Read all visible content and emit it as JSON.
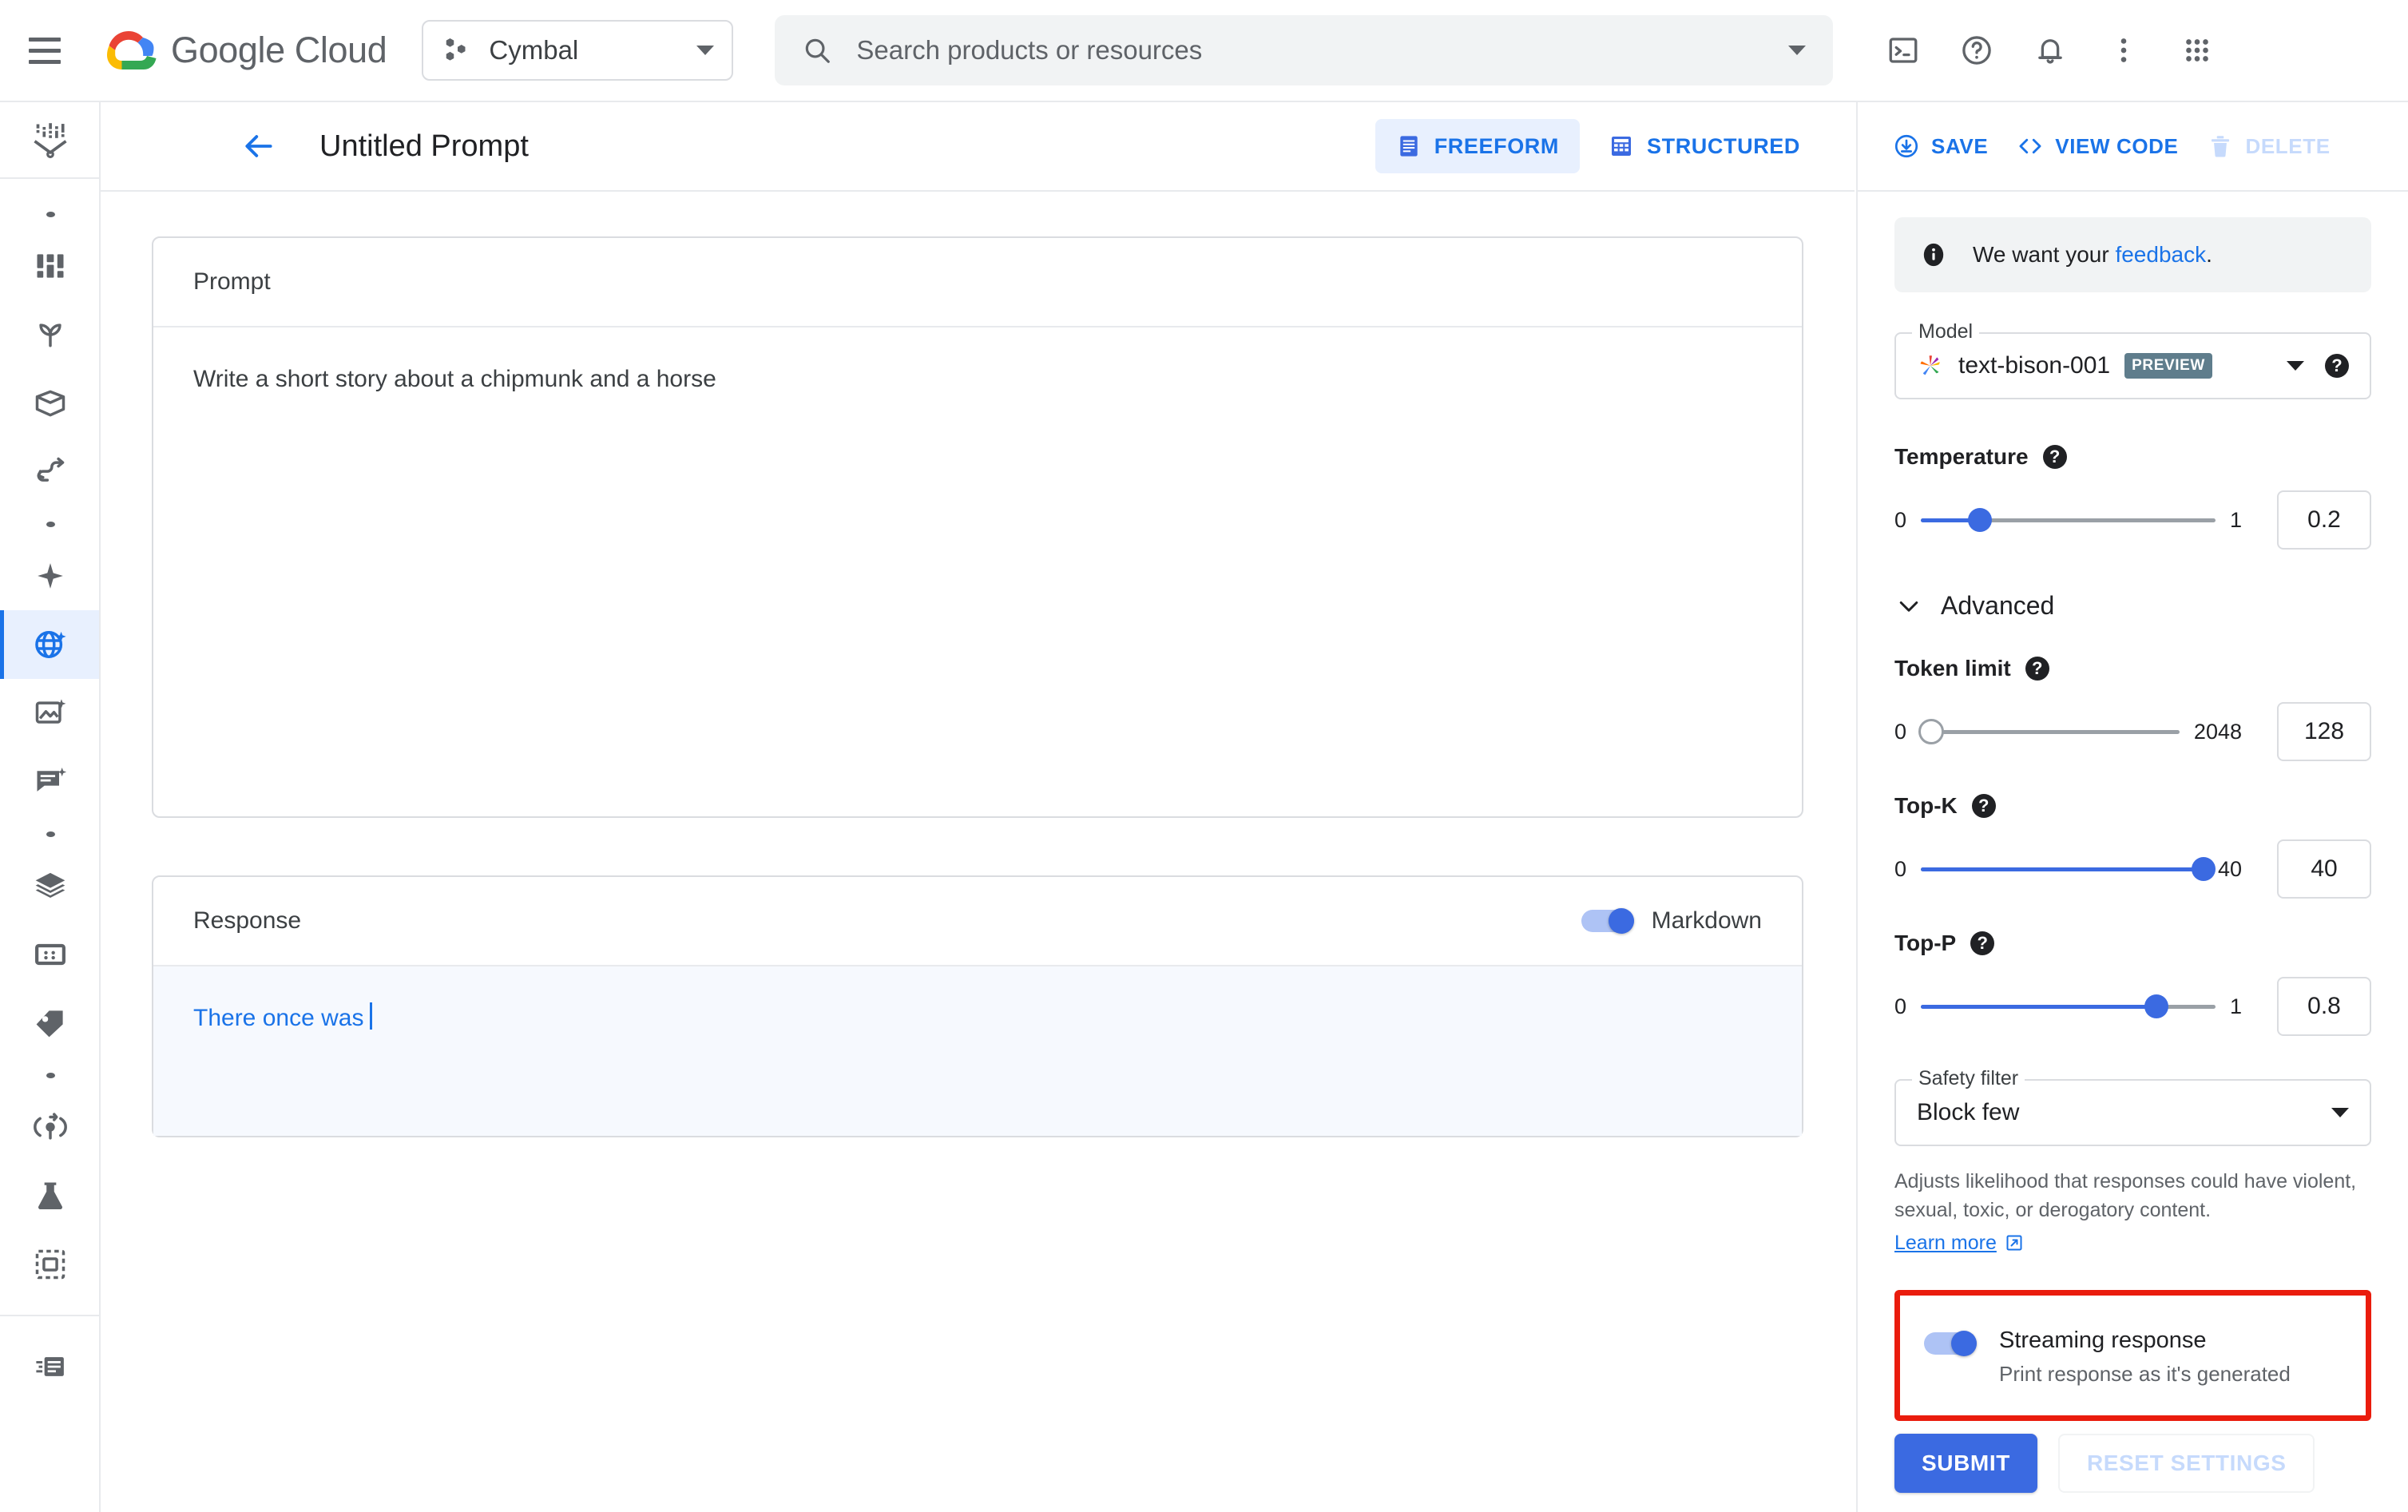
{
  "topbar": {
    "menu_icon": "hamburger-menu-icon",
    "brand": "Google Cloud",
    "project": {
      "name": "Cymbal",
      "icon": "project-hexagons-icon"
    },
    "search": {
      "placeholder": "Search products or resources",
      "value": "",
      "icon": "search-icon"
    },
    "icons": [
      "cloud-shell-icon",
      "help-icon",
      "notifications-icon",
      "more-vert-icon",
      "apps-grid-icon"
    ]
  },
  "rail": {
    "items": [
      {
        "name": "vertex-ai-logo-icon",
        "type": "logo"
      },
      {
        "name": "section-dot",
        "type": "dot"
      },
      {
        "name": "dashboard-icon",
        "type": "icon"
      },
      {
        "name": "model-garden-icon",
        "type": "icon"
      },
      {
        "name": "pipelines-icon",
        "type": "icon"
      },
      {
        "name": "workflows-icon",
        "type": "icon"
      },
      {
        "name": "section-dot",
        "type": "dot"
      },
      {
        "name": "generative-sparkle-icon",
        "type": "icon"
      },
      {
        "name": "language-studio-icon",
        "type": "icon",
        "active": true
      },
      {
        "name": "vision-studio-icon",
        "type": "icon"
      },
      {
        "name": "chat-studio-icon",
        "type": "icon"
      },
      {
        "name": "section-dot",
        "type": "dot"
      },
      {
        "name": "datasets-icon",
        "type": "icon"
      },
      {
        "name": "feature-store-icon",
        "type": "icon"
      },
      {
        "name": "labeling-tasks-icon",
        "type": "icon"
      },
      {
        "name": "section-dot",
        "type": "dot"
      },
      {
        "name": "training-icon",
        "type": "icon"
      },
      {
        "name": "experiments-icon",
        "type": "icon"
      },
      {
        "name": "metadata-icon",
        "type": "icon"
      },
      {
        "name": "release-notes-icon",
        "type": "icon"
      }
    ]
  },
  "page": {
    "back_icon": "back-arrow-icon",
    "title": "Untitled Prompt",
    "tabs": [
      {
        "label": "FREEFORM",
        "icon": "freeform-document-icon",
        "selected": true
      },
      {
        "label": "STRUCTURED",
        "icon": "structured-table-icon",
        "selected": false
      }
    ]
  },
  "main": {
    "prompt_card": {
      "header": "Prompt",
      "text": "Write a short story about a chipmunk and a horse"
    },
    "response_card": {
      "header": "Response",
      "markdown_toggle": {
        "label": "Markdown",
        "on": true
      },
      "text": "There once was"
    }
  },
  "right": {
    "actions": [
      {
        "label": "SAVE",
        "icon": "save-download-icon",
        "disabled": false
      },
      {
        "label": "VIEW CODE",
        "icon": "code-brackets-icon",
        "disabled": false
      },
      {
        "label": "DELETE",
        "icon": "trash-icon",
        "disabled": true
      }
    ],
    "banner": {
      "icon": "info-icon",
      "text_before": "We want your ",
      "link": "feedback",
      "text_after": "."
    },
    "model": {
      "label": "Model",
      "value": "text-bison-001",
      "badge": "PREVIEW",
      "icon": "palm-model-icon",
      "help_icon": "help-circle-icon",
      "dropdown_icon": "caret-down-icon"
    },
    "temperature": {
      "label": "Temperature",
      "min": "0",
      "max": "1",
      "value": "0.2",
      "fill_percent": 20,
      "help_icon": "help-circle-icon"
    },
    "advanced": {
      "label": "Advanced",
      "icon": "chevron-down-icon",
      "expanded": true
    },
    "token_limit": {
      "label": "Token limit",
      "min": "0",
      "max": "2048",
      "value": "128",
      "fill_percent": 6,
      "help_icon": "help-circle-icon"
    },
    "top_k": {
      "label": "Top-K",
      "min": "0",
      "max": "40",
      "value": "40",
      "fill_percent": 100,
      "help_icon": "help-circle-icon"
    },
    "top_p": {
      "label": "Top-P",
      "min": "0",
      "max": "1",
      "value": "0.8",
      "fill_percent": 80,
      "help_icon": "help-circle-icon"
    },
    "safety_filter": {
      "label": "Safety filter",
      "value": "Block few",
      "description": "Adjusts likelihood that responses could have violent, sexual, toxic, or derogatory content.",
      "learn_more": "Learn more",
      "learn_more_icon": "external-link-icon"
    },
    "streaming": {
      "title": "Streaming response",
      "subtitle": "Print response as it's generated",
      "on": true,
      "highlight_color": "#ea1c0d"
    },
    "submit_label": "SUBMIT",
    "reset_label": "RESET SETTINGS"
  },
  "colors": {
    "accent_blue": "#1a73e8",
    "control_blue": "#3b6ae1",
    "toggle_track": "#aec3f5",
    "annotation_red": "#ea1c0d",
    "border": "#dadce0",
    "text_primary": "#202124",
    "text_secondary": "#5f6368"
  }
}
